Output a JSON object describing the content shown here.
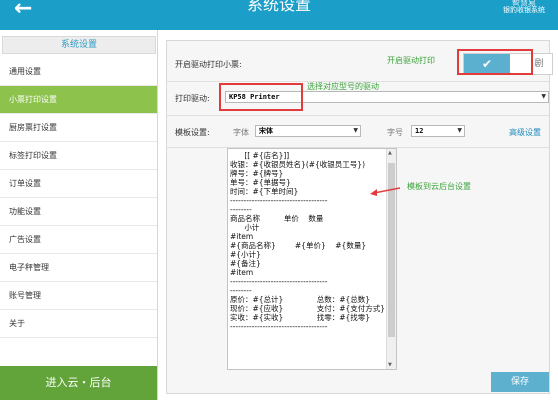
{
  "header": {
    "title": "系统设置",
    "brand_top": "智慧易",
    "brand_bottom": "银豹收银系统",
    "back_icon": "arrow-left-icon"
  },
  "sidebar": {
    "heading": "系统设置",
    "items": [
      {
        "label": "通用设置"
      },
      {
        "label": "小票打印设置"
      },
      {
        "label": "厨房票打设置"
      },
      {
        "label": "标签打印设置"
      },
      {
        "label": "订单设置"
      },
      {
        "label": "功能设置"
      },
      {
        "label": "广告设置"
      },
      {
        "label": "电子秤管理"
      },
      {
        "label": "账号管理"
      },
      {
        "label": "关于"
      }
    ],
    "active_index": 1,
    "bottom_button": "进入云・后台"
  },
  "settings": {
    "enable_driver_label": "开启驱动打印小票:",
    "enable_driver_hint": "开启驱动打印",
    "toggle_on_symbol": "✔",
    "toggle_off_label": "剧",
    "driver_label": "打印驱动:",
    "driver_value": "KP58 Printer",
    "driver_hint": "选择对应型号的驱动",
    "template_label": "模板设置:",
    "font_label": "字体",
    "font_value": "宋体",
    "size_label": "字号",
    "size_value": "12",
    "advanced_link": "高级设置",
    "template_hint": "模板到云后台设置",
    "template_text": "      [[ #{店名}]]\n收银：#{收银员姓名}(#{收银员工号})\n牌号：#{牌号}\n单号：#{单据号}\n时间：#{下单时间}\n------------------------------------\n--------\n商品名称          单价    数量\n      小计\n#item\n#{商品名称}        #{单价}    #{数量}      #{小计}\n#{备注}\n#item\n------------------------------------\n--------\n原价：#{总计}              总数：#{总数}\n现价：#{应收}              支付：#{支付方式}\n实收：#{实收}              找零：#{找零}\n------------------------------------",
    "save_button": "保存"
  },
  "colors": {
    "header": "#1b9fc9",
    "active_item": "#8dc24c",
    "cloud_button": "#63a43a",
    "accent_blue": "#5db1cf",
    "hint_green": "#3aa33a",
    "annotation_red": "#e23b3b"
  }
}
